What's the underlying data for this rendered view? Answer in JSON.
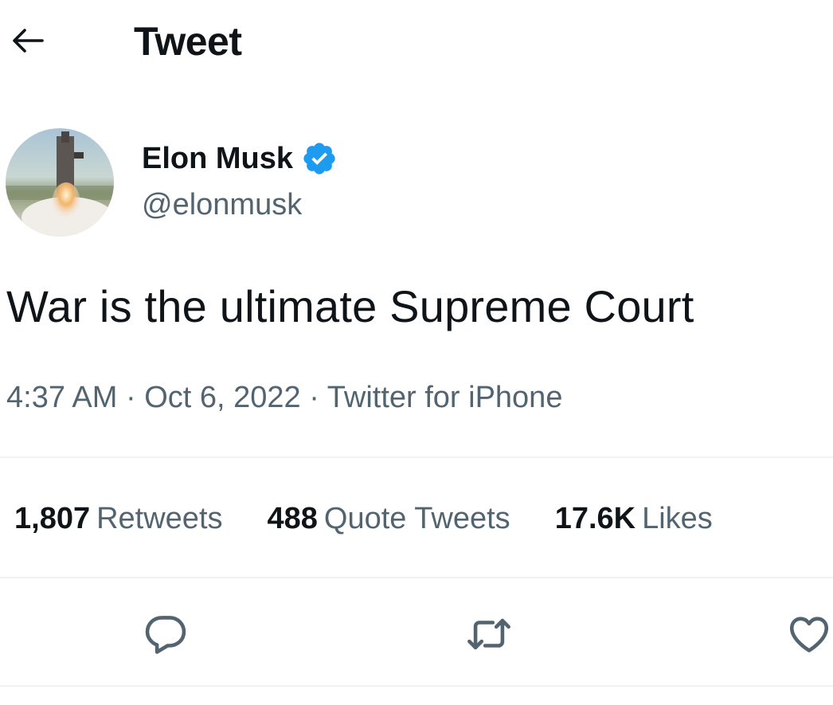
{
  "header": {
    "back_icon": "arrow-left-icon",
    "title": "Tweet"
  },
  "author": {
    "name": "Elon Musk",
    "handle": "@elonmusk",
    "verified_icon": "verified-badge-icon",
    "verified_color": "#1d9bf0"
  },
  "tweet": {
    "text": "War is the ultimate Supreme Court",
    "time": "4:37 AM",
    "separator": "·",
    "date": "Oct 6, 2022",
    "source": "Twitter for iPhone"
  },
  "stats": [
    {
      "count": "1,807",
      "label": "Retweets"
    },
    {
      "count": "488",
      "label": "Quote Tweets"
    },
    {
      "count": "17.6K",
      "label": "Likes"
    }
  ],
  "actions": {
    "reply_icon": "reply-icon",
    "retweet_icon": "retweet-icon",
    "like_icon": "heart-icon"
  },
  "colors": {
    "text_primary": "#0f1419",
    "text_secondary": "#536471",
    "divider": "#eff3f4",
    "icon": "#536471"
  }
}
